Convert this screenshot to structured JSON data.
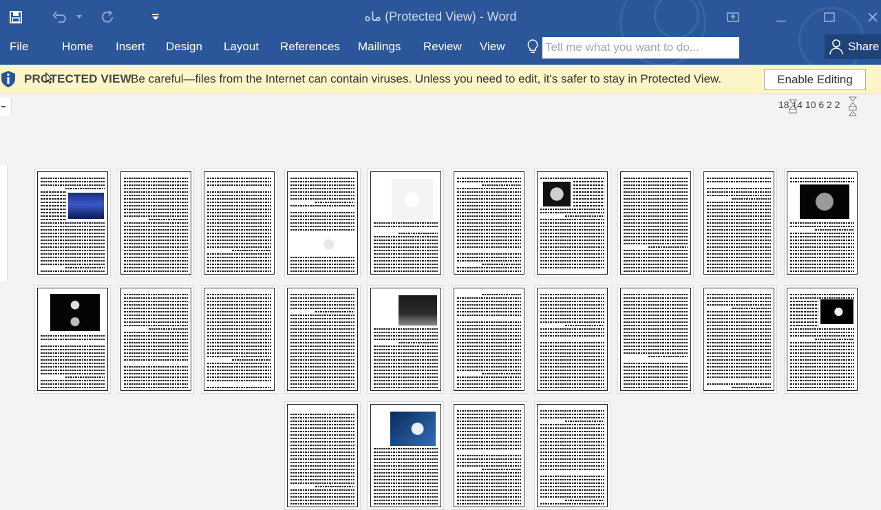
{
  "window": {
    "title": "ماه (Protected View) - Word",
    "colors": {
      "title_bar": "#2b579a",
      "protected_bar": "#fcf5c7"
    }
  },
  "quick_access": [
    "save-icon",
    "undo-icon",
    "redo-icon",
    "customize-icon"
  ],
  "ribbon_tabs": [
    "File",
    "Home",
    "Insert",
    "Design",
    "Layout",
    "References",
    "Mailings",
    "Review",
    "View"
  ],
  "tell_me": {
    "placeholder": "Tell me what you want to do..."
  },
  "share_label": "Share",
  "protected_view": {
    "title": "PROTECTED VIEW",
    "message": "Be careful—files from the Internet can contain viruses. Unless you need to edit, it's safer to stay in Protected View.",
    "button": "Enable Editing"
  },
  "ruler": {
    "numbers": "18 14 10 6 2 2"
  },
  "pages": [
    {
      "image": "moon-over-sea"
    },
    {
      "image": null
    },
    {
      "image": null
    },
    {
      "image": "diagram"
    },
    {
      "image": "moon-phases"
    },
    {
      "image": null
    },
    {
      "image": "full-moon"
    },
    {
      "image": null
    },
    {
      "image": null
    },
    {
      "image": "full-moon-large"
    },
    {
      "image": "two-moons"
    },
    {
      "image": null
    },
    {
      "image": null
    },
    {
      "image": null
    },
    {
      "image": "astronaut"
    },
    {
      "image": null
    },
    {
      "image": null
    },
    {
      "image": null
    },
    {
      "image": null
    },
    {
      "image": "crescent"
    },
    {
      "image": null
    },
    {
      "image": "crescent-blue"
    },
    {
      "image": null
    },
    {
      "image": null
    }
  ]
}
